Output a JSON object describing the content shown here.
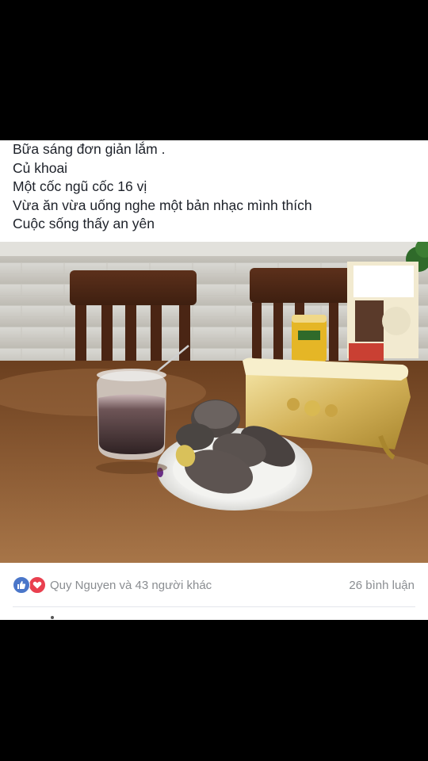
{
  "post": {
    "lines": [
      "Bữa sáng đơn giản lắm .",
      "Củ khoai",
      "Một cốc ngũ cốc 16 vị",
      "Vừa ăn vừa uống nghe một bản nhạc mình thích",
      "Cuộc sống thấy an yên"
    ]
  },
  "reactions": {
    "summary": "Quy Nguyen và 43 người khác",
    "icons": [
      "like-icon",
      "love-icon"
    ],
    "like_color": "#4a76c9",
    "love_color": "#e9404f"
  },
  "comments": {
    "count_label": "26 bình luận"
  },
  "colors": {
    "background": "#000000",
    "card": "#ffffff",
    "text": "#1d2129",
    "muted": "#8a8d91"
  }
}
